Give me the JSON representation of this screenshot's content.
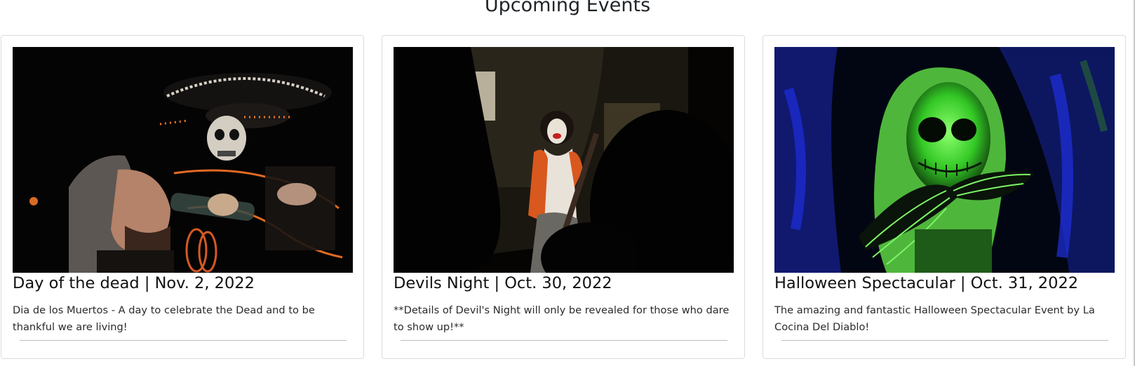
{
  "page": {
    "title": "Upcoming Events"
  },
  "events": [
    {
      "title": "Day of the dead | Nov. 2, 2022",
      "description": "Dia de los Muertos - A day to celebrate the Dead and to be thankful we are living!",
      "image_icon": "skeleton-mariachi-photo-icon"
    },
    {
      "title": "Devils Night | Oct. 30, 2022",
      "description": "**Details of Devil's Night will only be revealed for those who dare to show up!**",
      "image_icon": "clown-photo-icon"
    },
    {
      "title": "Halloween Spectacular | Oct. 31, 2022",
      "description": "The amazing and fantastic Halloween Spectacular Event by La Cocina Del Diablo!",
      "image_icon": "green-skull-photo-icon"
    }
  ],
  "colors": {
    "text": "#212529",
    "card_border": "#dcdcdc",
    "divider": "#bdbdbd",
    "accent_orange": "#d8581e",
    "accent_green": "#5dff4a",
    "accent_blue": "#1c2bd1"
  }
}
